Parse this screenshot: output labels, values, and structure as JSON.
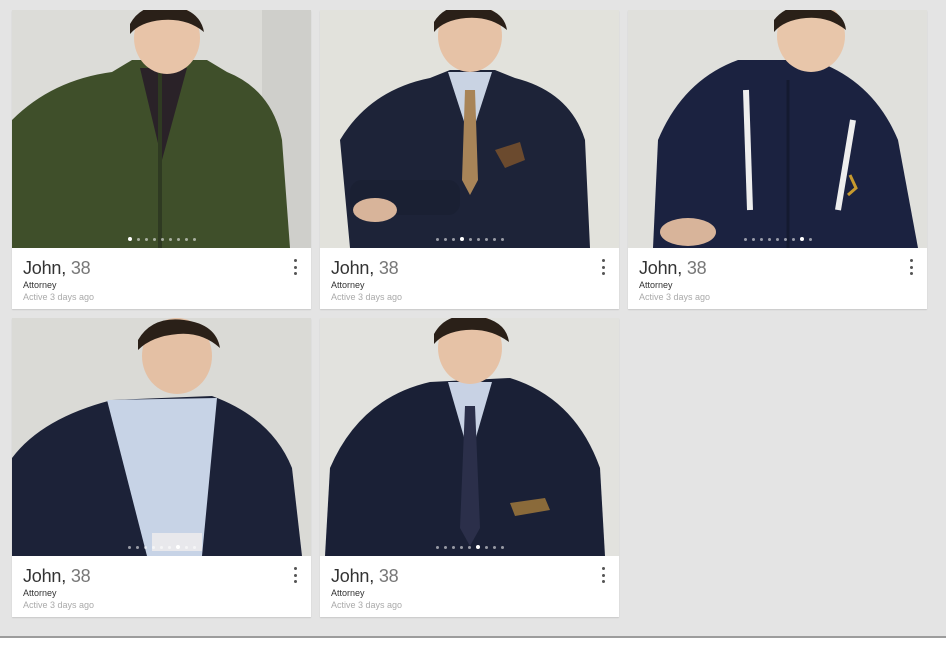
{
  "profiles": [
    {
      "name": "John",
      "sep": ", ",
      "age": "38",
      "job": "Attorney",
      "active": "Active 3 days ago",
      "dots": 9,
      "active_dot": 0,
      "outfit": "green-sweater"
    },
    {
      "name": "John",
      "sep": ", ",
      "age": "38",
      "job": "Attorney",
      "active": "Active 3 days ago",
      "dots": 9,
      "active_dot": 3,
      "outfit": "suit-tan-tie"
    },
    {
      "name": "John",
      "sep": ", ",
      "age": "38",
      "job": "Attorney",
      "active": "Active 3 days ago",
      "dots": 9,
      "active_dot": 7,
      "outfit": "navy-hoodie"
    },
    {
      "name": "John",
      "sep": ", ",
      "age": "38",
      "job": "Attorney",
      "active": "Active 3 days ago",
      "dots": 9,
      "active_dot": 6,
      "outfit": "blazer-open-collar"
    },
    {
      "name": "John",
      "sep": ", ",
      "age": "38",
      "job": "Attorney",
      "active": "Active 3 days ago",
      "dots": 9,
      "active_dot": 5,
      "outfit": "suit-navy-tie"
    }
  ],
  "icons": {
    "more": "more-vertical-icon"
  },
  "colors": {
    "background": "#e4e4e4",
    "card": "#ffffff"
  }
}
